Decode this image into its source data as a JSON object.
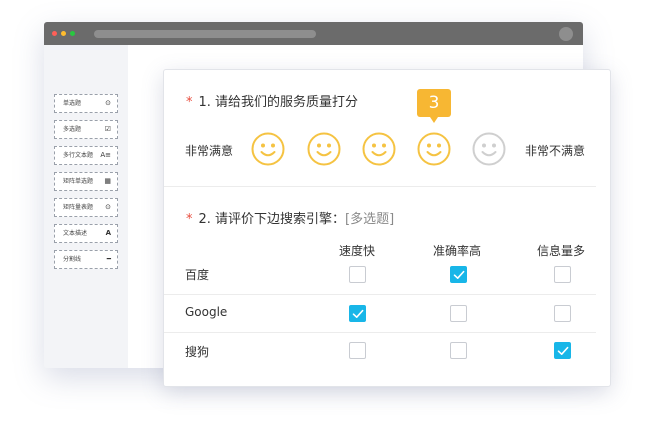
{
  "palette": {
    "items": [
      {
        "label": "单选题",
        "icon": "⊙",
        "icon_name": "radio-icon"
      },
      {
        "label": "多选题",
        "icon": "☑",
        "icon_name": "checkbox-icon"
      },
      {
        "label": "多行文本题",
        "icon": "A≡",
        "icon_name": "textarea-icon"
      },
      {
        "label": "矩阵单选题",
        "icon": "▦",
        "icon_name": "matrix-radio-icon"
      },
      {
        "label": "矩阵量表题",
        "icon": "⊙",
        "icon_name": "matrix-scale-icon"
      },
      {
        "label": "文本描述",
        "icon": "A",
        "icon_name": "text-icon"
      },
      {
        "label": "分割线",
        "icon": "━",
        "icon_name": "divider-icon"
      }
    ]
  },
  "survey": {
    "q1": {
      "required_mark": "*",
      "title": "1. 请给我们的服务质量打分",
      "left_label": "非常满意",
      "right_label": "非常不满意",
      "rating_value": "3",
      "face_count": 5,
      "selected_index": 3,
      "highlight_color": "#f7b733",
      "face_color": "#f5c342",
      "disabled_face_color": "#cfcfcf"
    },
    "q2": {
      "required_mark": "*",
      "title": "2. 请评价下边搜索引擎：",
      "type_hint": "[多选题]",
      "columns": [
        "速度快",
        "准确率高",
        "信息量多"
      ],
      "rows": [
        {
          "label": "百度",
          "checked": [
            false,
            true,
            false
          ]
        },
        {
          "label": "Google",
          "checked": [
            true,
            false,
            false
          ]
        },
        {
          "label": "搜狗",
          "checked": [
            false,
            false,
            true
          ]
        }
      ],
      "check_color": "#18b6e8"
    }
  }
}
